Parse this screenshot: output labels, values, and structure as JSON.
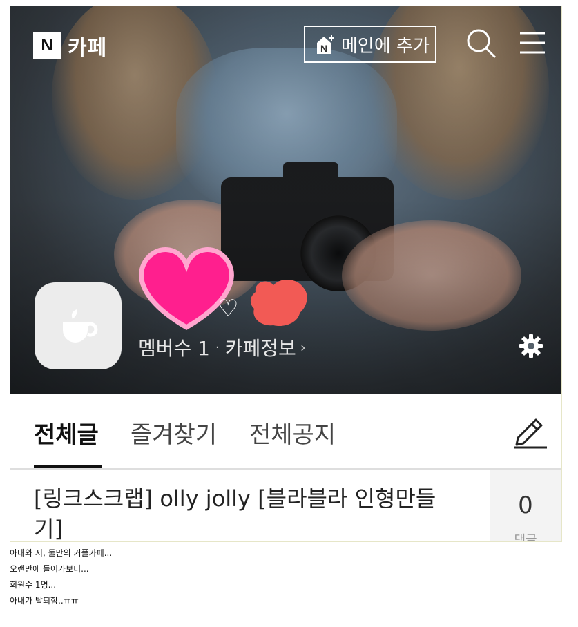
{
  "header": {
    "logo_letter": "N",
    "logo_text": "카페",
    "add_main_label": "메인에 추가",
    "icons": [
      "naver-home-add-icon",
      "search-icon",
      "hamburger-menu-icon"
    ]
  },
  "cafe": {
    "name_visible_fragment": "♡",
    "members_text": "멤버수 1",
    "info_link": "카페정보",
    "icons": [
      "cafe-cup-icon",
      "gear-icon"
    ]
  },
  "tabs": [
    {
      "label": "전체글",
      "active": true
    },
    {
      "label": "즐겨찾기",
      "active": false
    },
    {
      "label": "전체공지",
      "active": false
    }
  ],
  "write_icon": "pencil-icon",
  "post": {
    "title": "[링크스크랩] olly jolly [블라블라 인형만들기]",
    "comment_count": "0",
    "comment_label": "댓글"
  },
  "captions": [
    "아내와 저, 둘만의 커플카페...",
    "오랜만에 들어가보니...",
    "회원수 1명...",
    "아내가 탈퇴함..ㅠㅠ"
  ],
  "colors": {
    "heart_pink": "#ff1f8e",
    "blob_red": "#f25a55",
    "tab_active": "#111111",
    "tab_inactive": "#444444"
  }
}
